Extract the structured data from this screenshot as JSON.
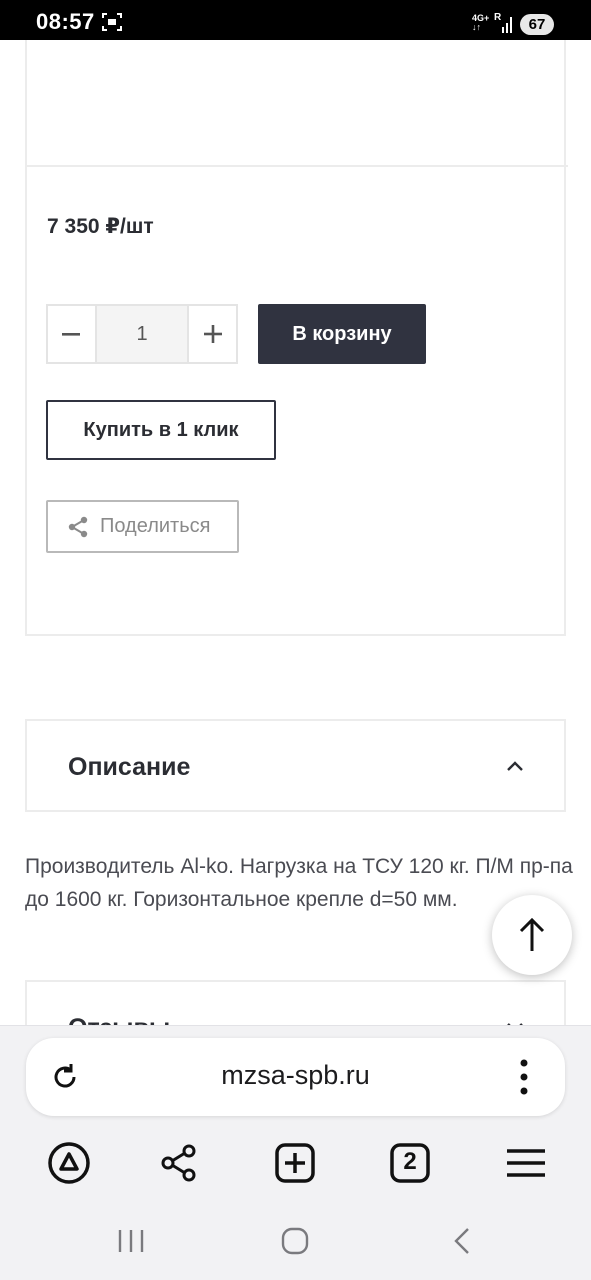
{
  "status_bar": {
    "time": "08:57",
    "network_top": "4G+",
    "network_arrows": "↓↑",
    "signal_label": "R",
    "battery": "67"
  },
  "product": {
    "price": "7 350 ₽/шт",
    "quantity": "1",
    "add_to_cart_label": "В корзину",
    "buy_one_click_label": "Купить в 1 клик",
    "share_label": "Поделиться"
  },
  "description": {
    "title": "Описание",
    "text": "Производитель Al-ko. Нагрузка на ТСУ 120 кг. П/М пр-па до 1600 кг. Горизонтальное крепле d=50 мм."
  },
  "reviews": {
    "title": "Отзывы"
  },
  "browser": {
    "url": "mzsa-spb.ru",
    "tabs_count": "2"
  },
  "colors": {
    "accent_dark": "#303340",
    "border_light": "#ececec",
    "text_primary": "#2b2d33"
  }
}
